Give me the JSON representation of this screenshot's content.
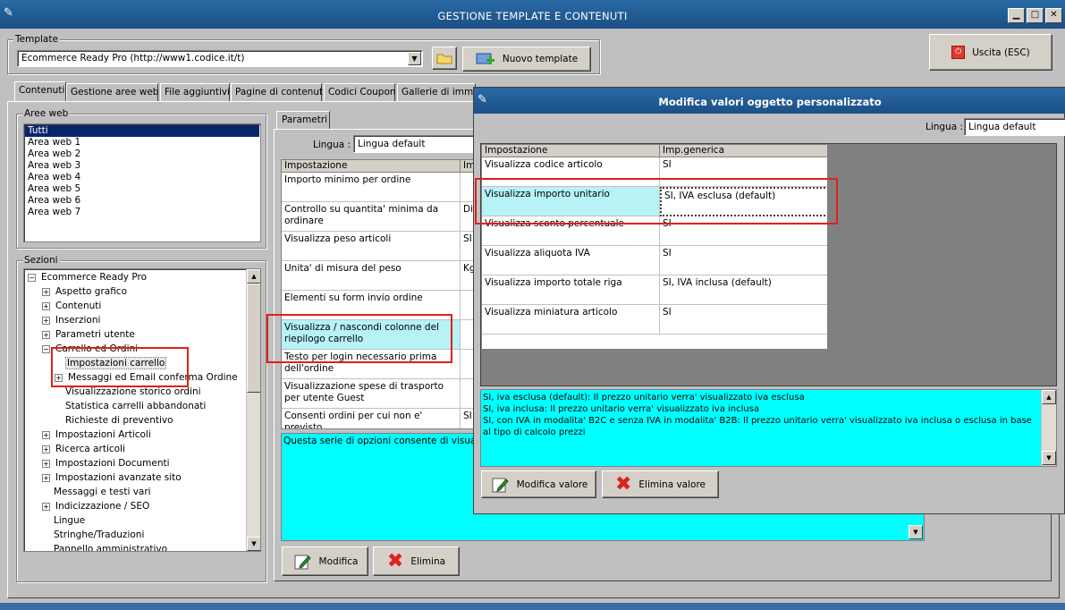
{
  "window": {
    "title": "GESTIONE TEMPLATE E CONTENUTI",
    "min_label": "▁",
    "max_label": "□",
    "close_label": "✕"
  },
  "template": {
    "group_label": "Template",
    "selected": "Ecommerce Ready Pro (http://www1.codice.it/t)",
    "new_button": "Nuovo template"
  },
  "exit_button": "Uscita (ESC)",
  "tabs": [
    "Contenuti",
    "Gestione aree web",
    "File aggiuntivi",
    "Pagine di contenuti",
    "Codici Coupon",
    "Gallerie di immag"
  ],
  "aree_web": {
    "label": "Aree web",
    "items": [
      "Tutti",
      "Area web 1",
      "Area web 2",
      "Area web 3",
      "Area web 4",
      "Area web 5",
      "Area web 6",
      "Area web 7"
    ]
  },
  "sezioni": {
    "label": "Sezioni",
    "root": "Ecommerce Ready Pro",
    "items": [
      {
        "label": "Aspetto grafico",
        "exp": "+"
      },
      {
        "label": "Contenuti",
        "exp": "+"
      },
      {
        "label": "Inserzioni",
        "exp": "+"
      },
      {
        "label": "Parametri utente",
        "exp": "+"
      },
      {
        "label": "Carrello ed Ordini",
        "exp": "−"
      },
      {
        "label": "Impostazioni carrello",
        "exp": ""
      },
      {
        "label": "Messaggi ed Email conferma Ordine",
        "exp": "+"
      },
      {
        "label": "Visualizzazione storico ordini",
        "exp": ""
      },
      {
        "label": "Statistica carrelli abbandonati",
        "exp": ""
      },
      {
        "label": "Richieste di preventivo",
        "exp": ""
      },
      {
        "label": "Impostazioni Articoli",
        "exp": "+"
      },
      {
        "label": "Ricerca articoli",
        "exp": "+"
      },
      {
        "label": "Impostazioni Documenti",
        "exp": "+"
      },
      {
        "label": "Impostazioni avanzate sito",
        "exp": "+"
      },
      {
        "label": "Messaggi e testi vari",
        "exp": ""
      },
      {
        "label": "Indicizzazione / SEO",
        "exp": "+"
      },
      {
        "label": "Lingue",
        "exp": ""
      },
      {
        "label": "Stringhe/Traduzioni",
        "exp": ""
      },
      {
        "label": "Pannello amministrativo",
        "exp": ""
      }
    ]
  },
  "parametri": {
    "tab": "Parametri",
    "lingua_label": "Lingua :",
    "lingua_value": "Lingua default",
    "col_impostazione": "Impostazione",
    "col_value": "Im",
    "rows": [
      {
        "label": "Importo minimo per ordine",
        "value": ""
      },
      {
        "label": "Controllo su quantita' minima da ordinare",
        "value": "Di"
      },
      {
        "label": "Visualizza peso articoli",
        "value": "SI"
      },
      {
        "label": "Unita' di misura del peso",
        "value": "Kg"
      },
      {
        "label": "Elementi su form invio ordine",
        "value": ""
      },
      {
        "label": "Visualizza / nascondi colonne del riepilogo carrello",
        "value": ""
      },
      {
        "label": "Testo per login necessario prima dell'ordine",
        "value": ""
      },
      {
        "label": "Visualizzazione spese di trasporto per utente Guest",
        "value": ""
      },
      {
        "label": "Consenti ordini per cui non e' previsto",
        "value": "SI"
      }
    ],
    "description": "Questa serie di opzioni consente di visualizz",
    "modifica_button": "Modifica",
    "elimina_button": "Elimina"
  },
  "dialog": {
    "title": "Modifica valori oggetto personalizzato",
    "lingua_label": "Lingua :",
    "lingua_value": "Lingua default",
    "col_impostazione": "Impostazione",
    "col_value": "Imp.generica",
    "rows": [
      {
        "label": "Visualizza codice articolo",
        "value": "SI"
      },
      {
        "label": "Visualizza importo unitario",
        "value": "SI, IVA esclusa (default)"
      },
      {
        "label": "Visualizza sconto percentuale",
        "value": "SI"
      },
      {
        "label": "Visualizza aliquota IVA",
        "value": "SI"
      },
      {
        "label": "Visualizza importo totale riga",
        "value": "SI, IVA inclusa (default)"
      },
      {
        "label": "Visualizza miniatura articolo",
        "value": "SI"
      }
    ],
    "help_lines": [
      "SI, iva esclusa (default): Il prezzo unitario verra' visualizzato iva esclusa",
      "SI, iva inclusa: Il prezzo unitario verra' visualizzato iva inclusa",
      "SI, con IVA in modalita' B2C e senza IVA in modalita' B2B: Il prezzo unitario verra' visualizzato iva inclusa o esclusa in base al tipo di calcolo prezzi"
    ],
    "modifica_button": "Modifica valore",
    "elimina_button": "Elimina valore"
  },
  "colors": {
    "titlebar": "#1b4f86",
    "highlight_cyan": "#00ffff",
    "row_cyan": "#b6f2f6",
    "selection": "#0a246a",
    "annotation_red": "#e0201a",
    "grey_panel": "#808080"
  }
}
